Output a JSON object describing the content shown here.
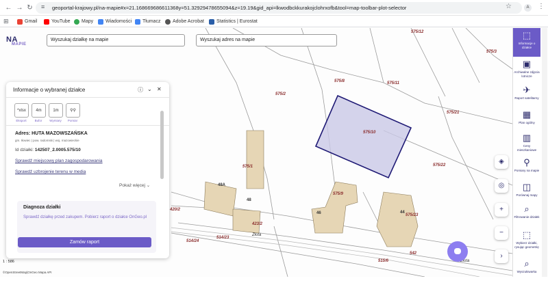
{
  "browser": {
    "url": "geoportal-krajowy.pl/na-mapie#x=21.168669686611368y=51.32929478655094&z=19.19&gid_api=lkwodbckkurakojclohrxofb&tool=map-toolbar-plot-selector",
    "profile_initial": "A",
    "bookmarks": [
      "Gmail",
      "YouTube",
      "Mapy",
      "Wiadomości",
      "Tłumacz",
      "Adobe Acrobat",
      "Statistics | Eurostat"
    ]
  },
  "logo": {
    "main": "NA",
    "sub": "MAPIE"
  },
  "search": {
    "plot_placeholder": "Wyszukaj działkę na mapie",
    "address_placeholder": "Wyszukaj adres na mapie"
  },
  "panel": {
    "title": "Informacje o wybranej działce",
    "tools": [
      {
        "icon": "*xlsx",
        "label": "Eksport"
      },
      {
        "icon": "4m",
        "label": "Bufor"
      },
      {
        "icon": "1m",
        "label": "Wymiary"
      },
      {
        "icon": "⚲⚲",
        "label": "Pomiar"
      }
    ],
    "address": "Adres: HUTA MAZOWSZAŃSKA",
    "address_sub": "gm. Iłowiec | pow. radomski | woj. mazowieckie",
    "plot_id_label": "Id działki:",
    "plot_id_value": "142507_2.0005.575/10",
    "link_plan": "Sprawdź miejscowy plan zagospodarowania",
    "link_media": "Sprawdź uzbrojenie terenu w media",
    "show_more": "Pokaż więcej",
    "diagnosis_title": "Diagnoza działki",
    "diagnosis_text": "Sprawdź działkę przed zakupem. Pobierz raport o działce OnGeo.pl",
    "order_button": "Zamów raport"
  },
  "map": {
    "plot_labels": [
      "575/12",
      "575/8",
      "575/11",
      "575/2",
      "575/10",
      "575/21",
      "575/22",
      "575/1",
      "575/9",
      "575/23",
      "575/3",
      "420/2",
      "423/2",
      "514/23",
      "514/24",
      "515/6",
      "542"
    ],
    "building_labels": [
      "48A",
      "48",
      "46",
      "44"
    ],
    "street_labels": [
      "Złota",
      "Złota"
    ],
    "scale": "1 : 586",
    "attribution": "©OpenStreetMap|OnGeo Mapa API"
  },
  "toolbar": [
    {
      "label": "Informacje o działce",
      "active": true
    },
    {
      "label": "Archiwalne zdjęcia lotnicze",
      "active": false
    },
    {
      "label": "Raport satelitarny",
      "active": false
    },
    {
      "label": "Plan ogólny",
      "active": false
    },
    {
      "label": "Ceny mieszkaniowe",
      "active": false
    },
    {
      "label": "Pomiary na mapie",
      "active": false
    },
    {
      "label": "Porównaj mapy",
      "active": false
    },
    {
      "label": "Filtrowanie działek",
      "active": false
    },
    {
      "label": "Wybierz działki, rysując geometrię",
      "active": false
    },
    {
      "label": "Wyszukiwarka",
      "active": false
    }
  ],
  "colors": {
    "accent": "#6b5bc7",
    "plot_outline": "#1f1a75",
    "plot_fill": "#c9c8e6"
  }
}
